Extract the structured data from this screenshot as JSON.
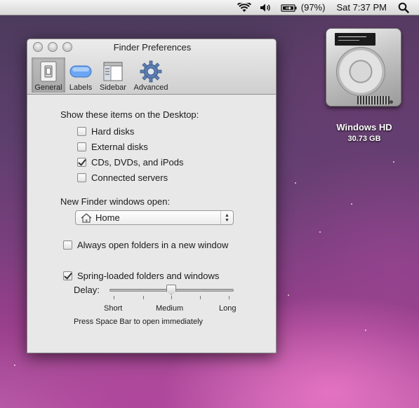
{
  "menubar": {
    "battery": "(97%)",
    "clock": "Sat 7:37 PM"
  },
  "desktop": {
    "drive": {
      "name": "Windows HD",
      "size": "30.73 GB"
    }
  },
  "window": {
    "title": "Finder Preferences",
    "tabs": [
      {
        "label": "General",
        "selected": true
      },
      {
        "label": "Labels",
        "selected": false
      },
      {
        "label": "Sidebar",
        "selected": false
      },
      {
        "label": "Advanced",
        "selected": false
      }
    ],
    "desktop_section": {
      "label": "Show these items on the Desktop:",
      "items": [
        {
          "label": "Hard disks",
          "checked": false
        },
        {
          "label": "External disks",
          "checked": false
        },
        {
          "label": "CDs, DVDs, and iPods",
          "checked": true
        },
        {
          "label": "Connected servers",
          "checked": false
        }
      ]
    },
    "new_window": {
      "label": "New Finder windows open:",
      "selected": "Home"
    },
    "always_open": {
      "label": "Always open folders in a new window",
      "checked": false
    },
    "spring": {
      "label": "Spring-loaded folders and windows",
      "checked": true,
      "delay_label": "Delay:",
      "ticks": [
        "Short",
        "Medium",
        "Long"
      ],
      "value": 0.5,
      "hint": "Press Space Bar to open immediately"
    }
  }
}
